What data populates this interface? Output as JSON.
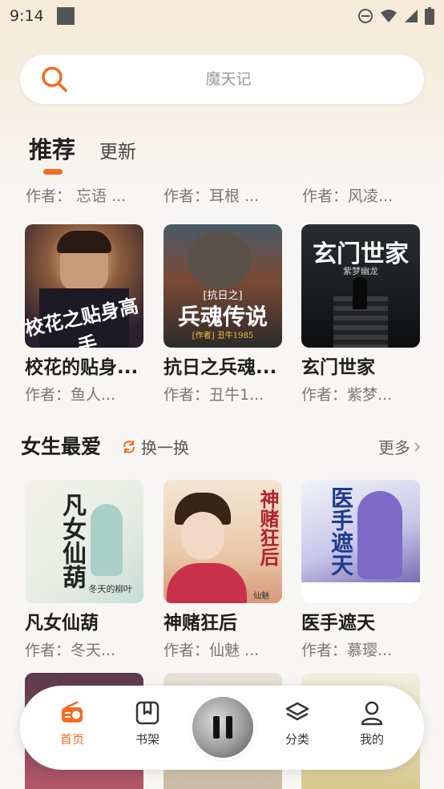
{
  "status_bar": {
    "time": "9:14"
  },
  "search": {
    "placeholder": "魔天记"
  },
  "tabs": [
    {
      "label": "推荐",
      "active": true
    },
    {
      "label": "更新",
      "active": false
    }
  ],
  "partial_row": [
    {
      "author": "作者：  忘语 ..."
    },
    {
      "author": "作者：耳根 ..."
    },
    {
      "author": "作者：风凌..."
    }
  ],
  "recommend_row": [
    {
      "title": "校花的贴身...",
      "author": "作者：鱼人...",
      "cover_text": "校花之贴身高手"
    },
    {
      "title": "抗日之兵魂...",
      "author": "作者：丑牛1...",
      "cover_text": "兵魂传说",
      "cover_sub": "[抗日之]",
      "cover_author": "[作者] 丑牛1985"
    },
    {
      "title": "玄门世家",
      "author": "作者：紫梦...",
      "cover_text": "玄门世家",
      "cover_sub": "紫梦幽龙"
    }
  ],
  "female_section": {
    "title": "女生最爱",
    "shuffle_label": "换一换",
    "more_label": "更多",
    "books": [
      {
        "title": "凡女仙葫",
        "author": "作者：冬天...",
        "cover_text": "凡女仙葫",
        "cover_sub": "冬天的柳叶"
      },
      {
        "title": "神赌狂后",
        "author": "作者：仙魅 ...",
        "cover_text": "神赌狂后",
        "cover_sub": "仙魅"
      },
      {
        "title": "医手遮天",
        "author": "作者：慕璎...",
        "cover_text": "医手遮天"
      }
    ]
  },
  "bottom_nav": {
    "items": [
      {
        "label": "首页",
        "active": true,
        "icon": "radio-icon"
      },
      {
        "label": "书架",
        "active": false,
        "icon": "bookmark-icon"
      },
      {
        "label": "分类",
        "active": false,
        "icon": "layers-icon"
      },
      {
        "label": "我的",
        "active": false,
        "icon": "user-icon"
      }
    ],
    "player_state": "playing"
  },
  "colors": {
    "accent": "#f36c21",
    "background": "#f7f6f4",
    "header": "#f6ead8"
  }
}
